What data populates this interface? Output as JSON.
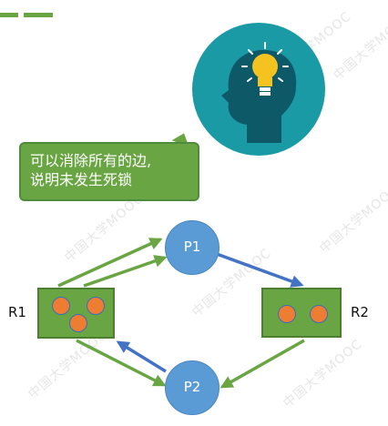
{
  "callout": {
    "line1": "可以消除所有的边,",
    "line2": "说明未发生死锁"
  },
  "watermark": "中国大学MOOC",
  "processes": {
    "p1": "P1",
    "p2": "P2"
  },
  "resources": {
    "r1": "R1",
    "r2": "R2"
  },
  "colors": {
    "accent_green": "#6aa544",
    "edge_green": "#6aa544",
    "edge_blue": "#4472c4",
    "process_blue": "#5b9bd5",
    "token_orange": "#ee7d31",
    "lightbulb_bg": "#1a9aa5"
  }
}
